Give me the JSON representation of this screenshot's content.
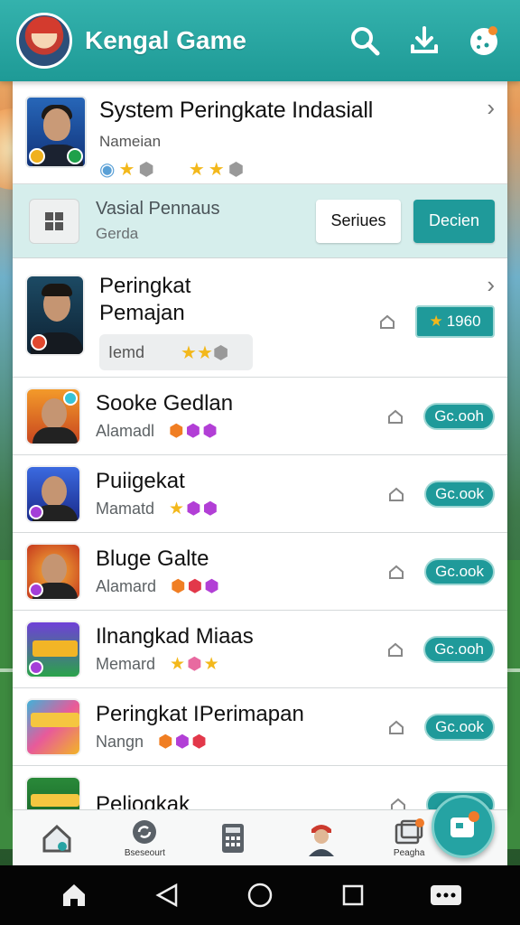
{
  "header": {
    "title": "Kengal Game",
    "icons": [
      "logo-avatar",
      "search-icon",
      "download-icon",
      "cookie-menu-icon"
    ]
  },
  "top_card": {
    "title": "System Peringkate Indasiall",
    "subtitle": "Nameian",
    "icons": [
      "badge-icon",
      "star",
      "dice",
      "star",
      "star",
      "dice"
    ]
  },
  "filter": {
    "title": "Vasial Pennaus",
    "subtitle": "Gerda",
    "button_secondary": "Seriues",
    "button_primary": "Decien"
  },
  "featured": {
    "title_line1": "Peringkat",
    "title_line2": "Pemajan",
    "tag": "Iemd",
    "score": "1960"
  },
  "rows": [
    {
      "title": "Sooke Gedlan",
      "subtitle": "Alamadl",
      "action": "Gc.ooh",
      "icons": [
        "cube-orange",
        "cube-purple",
        "cube-purple"
      ]
    },
    {
      "title": "Puiigekat",
      "subtitle": "Mamatd",
      "action": "Gc.ook",
      "icons": [
        "star",
        "cube-purple",
        "cube-purple"
      ]
    },
    {
      "title": "Bluge Galte",
      "subtitle": "Alamard",
      "action": "Gc.ook",
      "icons": [
        "cube-orange",
        "cube-red",
        "cube-purple"
      ]
    },
    {
      "title": "Ilnangkad Miaas",
      "subtitle": "Memard",
      "action": "Gc.ooh",
      "icons": [
        "star",
        "dice-pink",
        "star"
      ]
    },
    {
      "title": "Peringkat IPerimapan",
      "subtitle": "Nangn",
      "action": "Gc.ook",
      "icons": [
        "cube-orange",
        "cube-purple",
        "cube-red"
      ]
    },
    {
      "title": "Peliogkak",
      "subtitle": "",
      "action": "",
      "icons": []
    }
  ],
  "bottom_nav": [
    {
      "label": "",
      "icon": "home-icon"
    },
    {
      "label": "Bseseourt",
      "icon": "refresh-icon"
    },
    {
      "label": "",
      "icon": "calculator-icon"
    },
    {
      "label": "",
      "icon": "profile-icon"
    },
    {
      "label": "Peagha",
      "icon": "gallery-icon"
    }
  ],
  "fab": {
    "icon": "message-icon",
    "badge": "1"
  },
  "colors": {
    "primary": "#1f9a9a",
    "header": "#2aa9a4",
    "accent_star": "#f3b81b"
  }
}
